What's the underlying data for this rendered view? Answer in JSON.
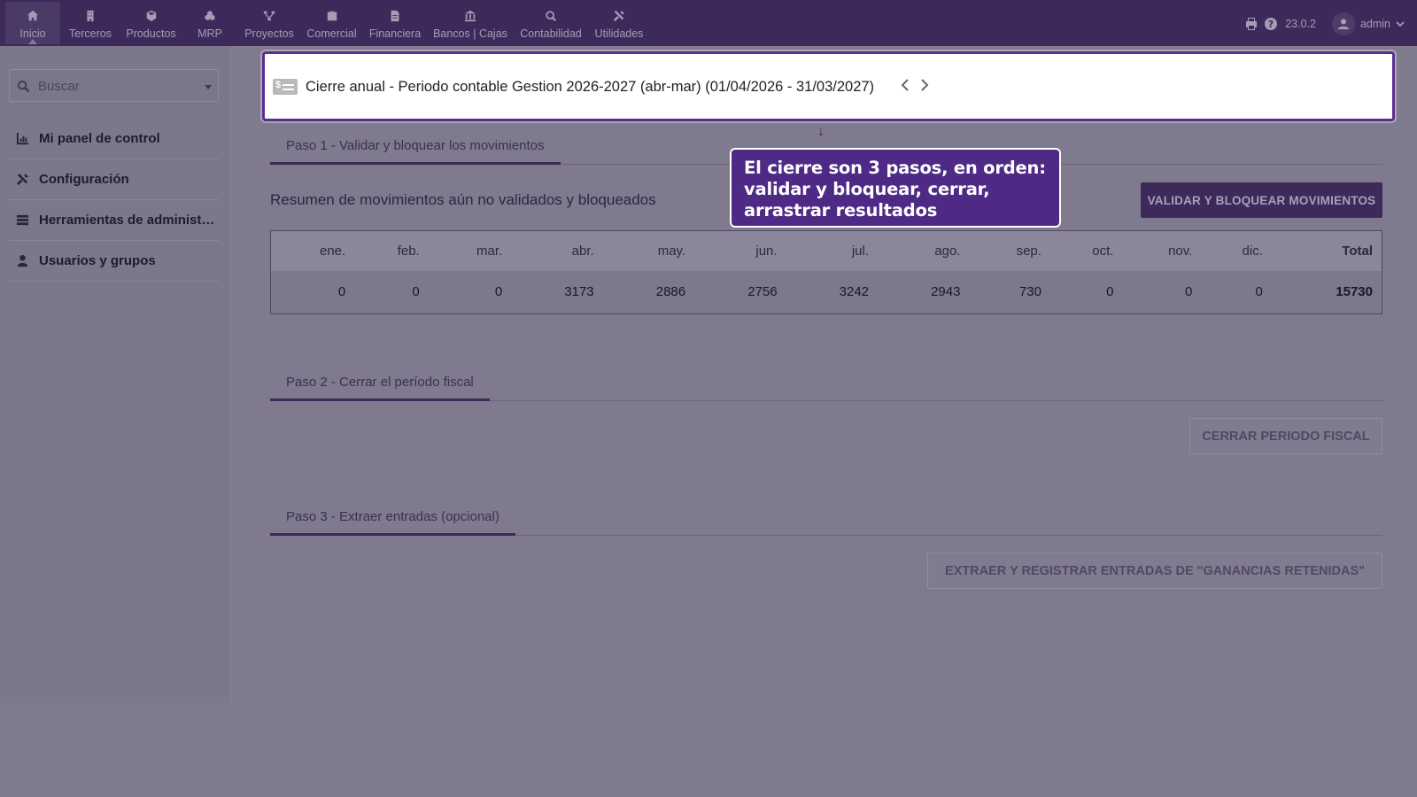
{
  "topnav": {
    "items": [
      {
        "label": "Inicio",
        "icon": "home-icon"
      },
      {
        "label": "Terceros",
        "icon": "building-icon"
      },
      {
        "label": "Productos",
        "icon": "cube-icon"
      },
      {
        "label": "MRP",
        "icon": "cubes-icon"
      },
      {
        "label": "Proyectos",
        "icon": "project-icon"
      },
      {
        "label": "Comercial",
        "icon": "briefcase-icon"
      },
      {
        "label": "Financiera",
        "icon": "file-icon"
      },
      {
        "label": "Bancos | Cajas",
        "icon": "bank-icon"
      },
      {
        "label": "Contabilidad",
        "icon": "magnify-icon"
      },
      {
        "label": "Utilidades",
        "icon": "tools-icon"
      }
    ],
    "version": "23.0.2",
    "user": "admin"
  },
  "sidebar": {
    "search_placeholder": "Buscar",
    "items": [
      {
        "label": "Mi panel de control",
        "icon": "chart-icon"
      },
      {
        "label": "Configuración",
        "icon": "tools-icon"
      },
      {
        "label": "Herramientas de administración",
        "icon": "server-icon"
      },
      {
        "label": "Usuarios y grupos",
        "icon": "user-icon"
      }
    ]
  },
  "header": {
    "title": "Cierre anual - Periodo contable Gestion 2026-2027 (abr-mar)  (01/04/2026 - 31/03/2027)"
  },
  "tooltip": {
    "text": "El cierre son 3 pasos, en orden: validar y bloquear, cerrar, arrastrar resultados"
  },
  "step1": {
    "tab": "Paso 1 - Validar y bloquear los movimientos",
    "summary": "Resumen de movimientos aún no validados y bloqueados",
    "button": "VALIDAR Y BLOQUEAR MOVIMIENTOS",
    "table": {
      "headers": [
        "ene.",
        "feb.",
        "mar.",
        "abr.",
        "may.",
        "jun.",
        "jul.",
        "ago.",
        "sep.",
        "oct.",
        "nov.",
        "dic.",
        "Total"
      ],
      "values": [
        "0",
        "0",
        "0",
        "3173",
        "2886",
        "2756",
        "3242",
        "2943",
        "730",
        "0",
        "0",
        "0",
        "15730"
      ]
    }
  },
  "step2": {
    "tab": "Paso 2 - Cerrar el período fiscal",
    "button": "CERRAR PERIODO FISCAL"
  },
  "step3": {
    "tab": "Paso 3 - Extraer entradas (opcional)",
    "button": "EXTRAER Y REGISTRAR ENTRADAS DE \"GANANCIAS RETENIDAS\""
  }
}
